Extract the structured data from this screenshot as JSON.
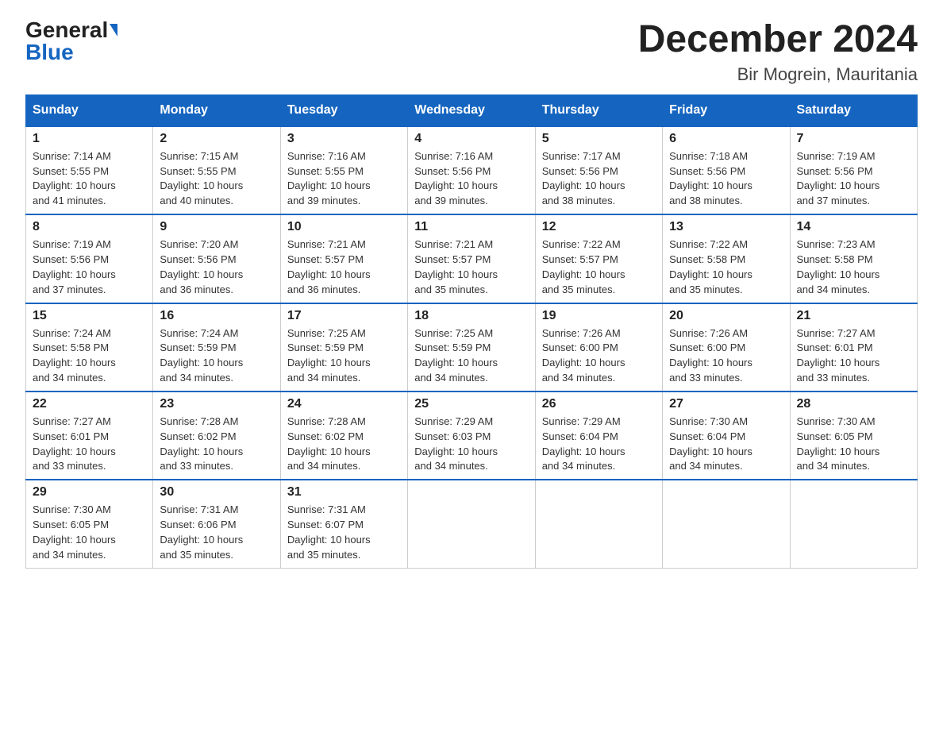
{
  "logo": {
    "general": "General",
    "blue": "Blue"
  },
  "title": "December 2024",
  "location": "Bir Mogrein, Mauritania",
  "days_of_week": [
    "Sunday",
    "Monday",
    "Tuesday",
    "Wednesday",
    "Thursday",
    "Friday",
    "Saturday"
  ],
  "weeks": [
    [
      {
        "day": "1",
        "sunrise": "7:14 AM",
        "sunset": "5:55 PM",
        "daylight": "10 hours and 41 minutes."
      },
      {
        "day": "2",
        "sunrise": "7:15 AM",
        "sunset": "5:55 PM",
        "daylight": "10 hours and 40 minutes."
      },
      {
        "day": "3",
        "sunrise": "7:16 AM",
        "sunset": "5:55 PM",
        "daylight": "10 hours and 39 minutes."
      },
      {
        "day": "4",
        "sunrise": "7:16 AM",
        "sunset": "5:56 PM",
        "daylight": "10 hours and 39 minutes."
      },
      {
        "day": "5",
        "sunrise": "7:17 AM",
        "sunset": "5:56 PM",
        "daylight": "10 hours and 38 minutes."
      },
      {
        "day": "6",
        "sunrise": "7:18 AM",
        "sunset": "5:56 PM",
        "daylight": "10 hours and 38 minutes."
      },
      {
        "day": "7",
        "sunrise": "7:19 AM",
        "sunset": "5:56 PM",
        "daylight": "10 hours and 37 minutes."
      }
    ],
    [
      {
        "day": "8",
        "sunrise": "7:19 AM",
        "sunset": "5:56 PM",
        "daylight": "10 hours and 37 minutes."
      },
      {
        "day": "9",
        "sunrise": "7:20 AM",
        "sunset": "5:56 PM",
        "daylight": "10 hours and 36 minutes."
      },
      {
        "day": "10",
        "sunrise": "7:21 AM",
        "sunset": "5:57 PM",
        "daylight": "10 hours and 36 minutes."
      },
      {
        "day": "11",
        "sunrise": "7:21 AM",
        "sunset": "5:57 PM",
        "daylight": "10 hours and 35 minutes."
      },
      {
        "day": "12",
        "sunrise": "7:22 AM",
        "sunset": "5:57 PM",
        "daylight": "10 hours and 35 minutes."
      },
      {
        "day": "13",
        "sunrise": "7:22 AM",
        "sunset": "5:58 PM",
        "daylight": "10 hours and 35 minutes."
      },
      {
        "day": "14",
        "sunrise": "7:23 AM",
        "sunset": "5:58 PM",
        "daylight": "10 hours and 34 minutes."
      }
    ],
    [
      {
        "day": "15",
        "sunrise": "7:24 AM",
        "sunset": "5:58 PM",
        "daylight": "10 hours and 34 minutes."
      },
      {
        "day": "16",
        "sunrise": "7:24 AM",
        "sunset": "5:59 PM",
        "daylight": "10 hours and 34 minutes."
      },
      {
        "day": "17",
        "sunrise": "7:25 AM",
        "sunset": "5:59 PM",
        "daylight": "10 hours and 34 minutes."
      },
      {
        "day": "18",
        "sunrise": "7:25 AM",
        "sunset": "5:59 PM",
        "daylight": "10 hours and 34 minutes."
      },
      {
        "day": "19",
        "sunrise": "7:26 AM",
        "sunset": "6:00 PM",
        "daylight": "10 hours and 34 minutes."
      },
      {
        "day": "20",
        "sunrise": "7:26 AM",
        "sunset": "6:00 PM",
        "daylight": "10 hours and 33 minutes."
      },
      {
        "day": "21",
        "sunrise": "7:27 AM",
        "sunset": "6:01 PM",
        "daylight": "10 hours and 33 minutes."
      }
    ],
    [
      {
        "day": "22",
        "sunrise": "7:27 AM",
        "sunset": "6:01 PM",
        "daylight": "10 hours and 33 minutes."
      },
      {
        "day": "23",
        "sunrise": "7:28 AM",
        "sunset": "6:02 PM",
        "daylight": "10 hours and 33 minutes."
      },
      {
        "day": "24",
        "sunrise": "7:28 AM",
        "sunset": "6:02 PM",
        "daylight": "10 hours and 34 minutes."
      },
      {
        "day": "25",
        "sunrise": "7:29 AM",
        "sunset": "6:03 PM",
        "daylight": "10 hours and 34 minutes."
      },
      {
        "day": "26",
        "sunrise": "7:29 AM",
        "sunset": "6:04 PM",
        "daylight": "10 hours and 34 minutes."
      },
      {
        "day": "27",
        "sunrise": "7:30 AM",
        "sunset": "6:04 PM",
        "daylight": "10 hours and 34 minutes."
      },
      {
        "day": "28",
        "sunrise": "7:30 AM",
        "sunset": "6:05 PM",
        "daylight": "10 hours and 34 minutes."
      }
    ],
    [
      {
        "day": "29",
        "sunrise": "7:30 AM",
        "sunset": "6:05 PM",
        "daylight": "10 hours and 34 minutes."
      },
      {
        "day": "30",
        "sunrise": "7:31 AM",
        "sunset": "6:06 PM",
        "daylight": "10 hours and 35 minutes."
      },
      {
        "day": "31",
        "sunrise": "7:31 AM",
        "sunset": "6:07 PM",
        "daylight": "10 hours and 35 minutes."
      },
      null,
      null,
      null,
      null
    ]
  ],
  "labels": {
    "sunrise": "Sunrise:",
    "sunset": "Sunset:",
    "daylight": "Daylight:"
  }
}
